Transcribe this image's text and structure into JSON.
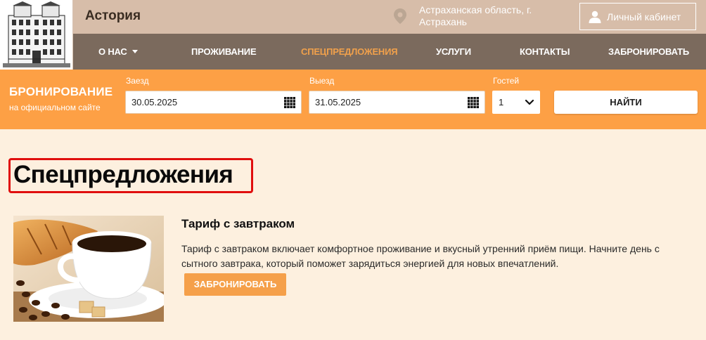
{
  "header": {
    "brand": "Астория",
    "location": "Астраханская область, г. Астрахань",
    "cabinet_label": "Личный кабинет"
  },
  "nav": {
    "items": [
      {
        "label": "О НАС"
      },
      {
        "label": "ПРОЖИВАНИЕ"
      },
      {
        "label": "СПЕЦПРЕДЛОЖЕНИЯ"
      },
      {
        "label": "УСЛУГИ"
      },
      {
        "label": "КОНТАКТЫ"
      },
      {
        "label": "ЗАБРОНИРОВАТЬ"
      }
    ],
    "active": "СПЕЦПРЕДЛОЖЕНИЯ"
  },
  "booking": {
    "title": "БРОНИРОВАНИЕ",
    "subtitle": "на официальном сайте",
    "checkin_label": "Заезд",
    "checkin_value": "30.05.2025",
    "checkout_label": "Выезд",
    "checkout_value": "31.05.2025",
    "guests_label": "Гостей",
    "guests_value": "1",
    "find_label": "НАЙТИ"
  },
  "main": {
    "page_title": "Спецпредложения",
    "offers": [
      {
        "title": "Тариф с завтраком",
        "description": "Тариф с завтраком включает комфортное проживание и вкусный утренний приём пищи. Начните день с сытного завтрака, который поможет зарядиться энергией для новых впечатлений.",
        "button_label": "ЗАБРОНИРОВАТЬ"
      }
    ]
  },
  "colors": {
    "topbar": "#d7bda9",
    "navbar": "#7b6a5d",
    "nav_active": "#f0a04b",
    "booking_bar": "#fda045",
    "page_bg": "#fdf0df",
    "accent_button": "#f5a04a",
    "highlight_border": "#e00e0e"
  },
  "icons": {
    "location": "map-pin-icon",
    "user": "user-icon",
    "calendar": "calendar-grid-icon",
    "dropdown": "chevron-down-icon"
  }
}
